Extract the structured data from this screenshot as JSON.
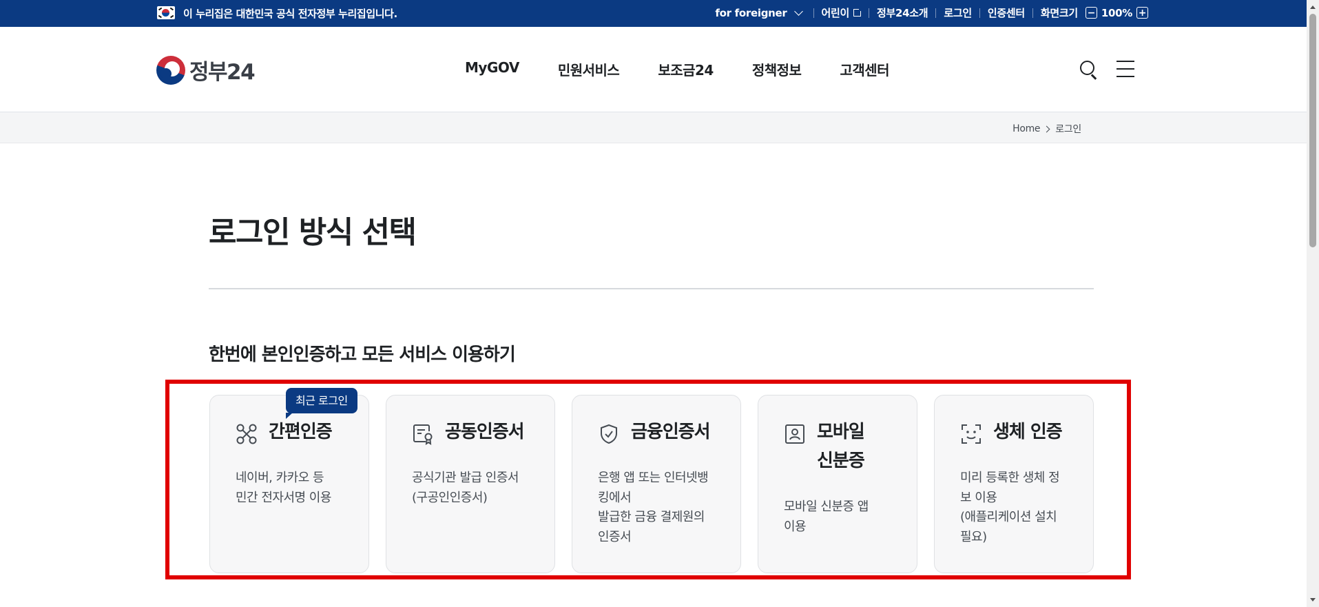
{
  "topbar": {
    "notice": "이 누리집은 대한민국 공식 전자정부 누리집입니다.",
    "for_foreigner": "for foreigner",
    "children": "어린이",
    "about": "정부24소개",
    "login": "로그인",
    "cert_center": "인증센터",
    "screen_size": "화면크기",
    "zoom_minus": "−",
    "zoom_value": "100%",
    "zoom_plus": "+"
  },
  "header": {
    "logo_text": "정부24",
    "nav": [
      "MyGOV",
      "민원서비스",
      "보조금24",
      "정책정보",
      "고객센터"
    ]
  },
  "breadcrumb": {
    "home": "Home",
    "current": "로그인"
  },
  "main": {
    "title": "로그인 방식 선택",
    "section_title": "한번에 본인인증하고 모든 서비스 이용하기",
    "badge": "최근 로그인",
    "cards": [
      {
        "title": "간편인증",
        "desc": "네이버, 카카오 등\n민간 전자서명 이용",
        "icon": "link-nodes-icon"
      },
      {
        "title": "공동인증서",
        "desc": "공식기관 발급 인증서\n(구공인인증서)",
        "icon": "certificate-icon"
      },
      {
        "title": "금융인증서",
        "desc": "은행 앱 또는 인터넷뱅\n킹에서\n발급한 금융 결제원의\n인증서",
        "icon": "shield-check-icon"
      },
      {
        "title": "모바일\n신분증",
        "desc": "모바일 신분증 앱\n이용",
        "icon": "id-card-icon"
      },
      {
        "title": "생체 인증",
        "desc": "미리 등록한 생체 정\n보 이용\n(애플리케이션 설치\n필요)",
        "icon": "face-scan-icon"
      }
    ]
  },
  "colors": {
    "brand_navy": "#0b3a82",
    "highlight_red": "#e00000",
    "card_bg": "#f7f7f8"
  }
}
